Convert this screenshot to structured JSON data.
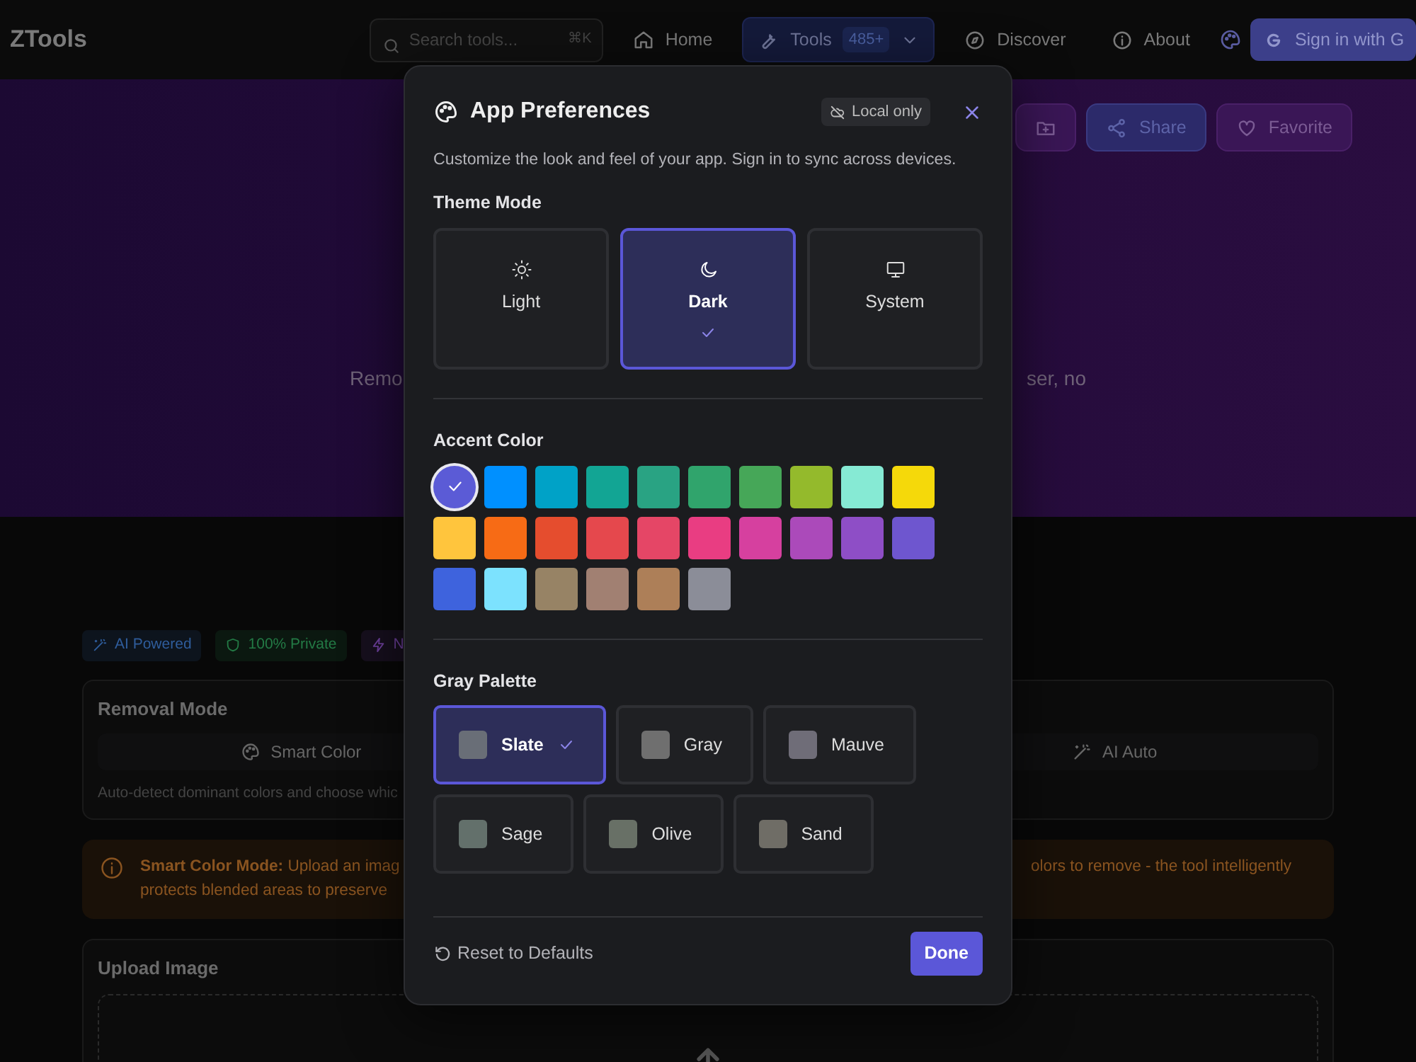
{
  "navbar": {
    "logo": "ZTools",
    "search": {
      "placeholder": "Search tools...",
      "shortcut": "⌘K"
    },
    "links": [
      {
        "label": "Home",
        "kind": "home",
        "selected": false
      },
      {
        "label": "Tools",
        "kind": "tools",
        "count": "485+",
        "selected": true
      },
      {
        "label": "Discover",
        "kind": "discover",
        "selected": false
      },
      {
        "label": "About",
        "kind": "about",
        "selected": false
      }
    ],
    "sign_in": "Sign in with G"
  },
  "hero": {
    "actions": [
      {
        "kind": "folder"
      },
      {
        "kind": "share",
        "label": "Share"
      },
      {
        "kind": "heart",
        "label": "Favorite"
      }
    ],
    "subtitle_left": "Remo",
    "subtitle_right": "ser, no"
  },
  "badges": [
    {
      "label": "AI Powered",
      "kind": "wand",
      "color": "#2f5d9c"
    },
    {
      "label": "100% Private",
      "kind": "shield",
      "color": "#237a45"
    },
    {
      "label": "N",
      "kind": "zap",
      "color": "#6c3f9a"
    }
  ],
  "removal_mode": {
    "title": "Removal Mode",
    "modes": [
      {
        "label": "Smart Color",
        "kind": "palette"
      },
      {
        "label": "AI Auto",
        "kind": "wand"
      }
    ],
    "description": "Auto-detect dominant colors and choose whic"
  },
  "alert": {
    "left_lines": [
      "**Smart Color Mode:** Upload an imag",
      "protects blended areas to preserve"
    ],
    "right_line": "olors to remove - the tool intelligently"
  },
  "upload": {
    "title": "Upload Image"
  },
  "dialog": {
    "title": "App Preferences",
    "badge": "Local only",
    "description": "Customize the look and feel of your app. Sign in to sync across devices.",
    "theme": {
      "label": "Theme Mode",
      "options": [
        {
          "label": "Light",
          "kind": "light",
          "selected": false
        },
        {
          "label": "Dark",
          "kind": "dark",
          "selected": true
        },
        {
          "label": "System",
          "kind": "system",
          "selected": false
        }
      ]
    },
    "accent": {
      "label": "Accent Color",
      "colors": [
        {
          "color": "#5b5bd6",
          "selected": true
        },
        {
          "color": "#0090ff",
          "selected": false
        },
        {
          "color": "#00a2c7",
          "selected": false
        },
        {
          "color": "#12a594",
          "selected": false
        },
        {
          "color": "#29a383",
          "selected": false
        },
        {
          "color": "#30a46c",
          "selected": false
        },
        {
          "color": "#46a758",
          "selected": false
        },
        {
          "color": "#94ba2c",
          "selected": false
        },
        {
          "color": "#86ead4",
          "selected": false
        },
        {
          "color": "#f5d90a",
          "selected": false
        },
        {
          "color": "#ffc53d",
          "selected": false
        },
        {
          "color": "#f76b15",
          "selected": false
        },
        {
          "color": "#e54d2e",
          "selected": false
        },
        {
          "color": "#e5484d",
          "selected": false
        },
        {
          "color": "#e54666",
          "selected": false
        },
        {
          "color": "#e93d82",
          "selected": false
        },
        {
          "color": "#d6409f",
          "selected": false
        },
        {
          "color": "#ab4aba",
          "selected": false
        },
        {
          "color": "#8e4ec6",
          "selected": false
        },
        {
          "color": "#6e56cf",
          "selected": false
        },
        {
          "color": "#3e63dd",
          "selected": false
        },
        {
          "color": "#7ce2fe",
          "selected": false
        },
        {
          "color": "#978365",
          "selected": false
        },
        {
          "color": "#a18072",
          "selected": false
        },
        {
          "color": "#ad7f58",
          "selected": false
        },
        {
          "color": "#8b8d98",
          "selected": false
        }
      ]
    },
    "gray": {
      "label": "Gray Palette",
      "options": [
        {
          "label": "Slate",
          "color": "#696e77",
          "selected": true
        },
        {
          "label": "Gray",
          "color": "#6f6f6f",
          "selected": false
        },
        {
          "label": "Mauve",
          "color": "#6f6d78",
          "selected": false
        },
        {
          "label": "Sage",
          "color": "#63706b",
          "selected": false
        },
        {
          "label": "Olive",
          "color": "#687066",
          "selected": false
        },
        {
          "label": "Sand",
          "color": "#6f6d66",
          "selected": false
        }
      ]
    },
    "reset": "Reset to Defaults",
    "done": "Done"
  }
}
